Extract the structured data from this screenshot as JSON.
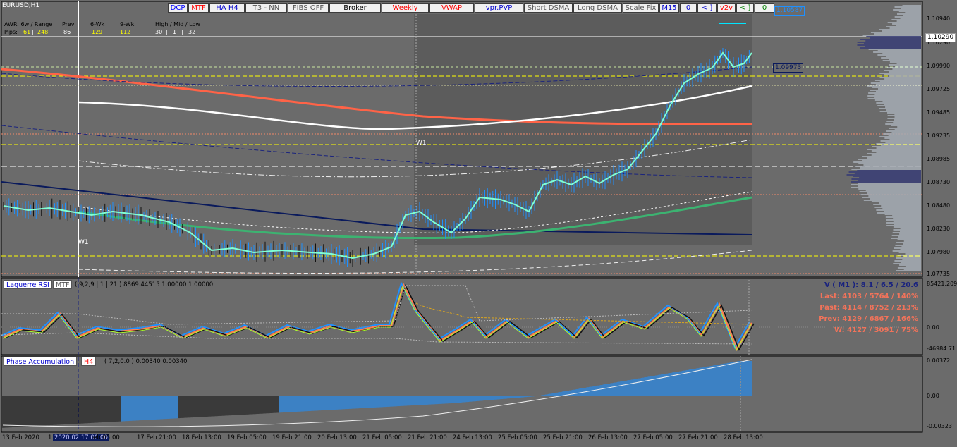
{
  "symbol": "EURUSD,H1",
  "toolbar": [
    {
      "label": "DCP",
      "color": "#0000ff",
      "bg": "#f0f0f0"
    },
    {
      "label": "MTF",
      "color": "#ff0000",
      "bg": "#f0f0f0"
    },
    {
      "label": "HA H4",
      "color": "#0000cc",
      "bg": "#f0f0f0"
    },
    {
      "label": "T3 - NN",
      "color": "#555555",
      "bg": "#f0f0f0"
    },
    {
      "label": "FIBS OFF",
      "color": "#555555",
      "bg": "#f0f0f0"
    },
    {
      "label": "Broker",
      "color": "#000000",
      "bg": "#f0f0f0"
    },
    {
      "label": "Weekly",
      "color": "#ff0000",
      "bg": "#f0f0f0"
    },
    {
      "label": "VWAP",
      "color": "#ff0000",
      "bg": "#f0f0f0"
    },
    {
      "label": "vpr.PVP",
      "color": "#0000cc",
      "bg": "#f0f0f0"
    },
    {
      "label": "Short DSMA",
      "color": "#555555",
      "bg": "#f0f0f0"
    },
    {
      "label": "Long DSMA",
      "color": "#555555",
      "bg": "#f0f0f0"
    },
    {
      "label": "Scale Fix",
      "color": "#555555",
      "bg": "#f0f0f0"
    },
    {
      "label": "M15",
      "color": "#0000cc",
      "bg": "#f0f0f0"
    },
    {
      "label": "0",
      "color": "#0000cc",
      "bg": "#f0f0f0"
    },
    {
      "label": "< ]",
      "color": "#0000cc",
      "bg": "#f0f0f0"
    },
    {
      "label": "v2v",
      "color": "#ff0000",
      "bg": "#f0f0f0"
    },
    {
      "label": "< ]",
      "color": "#008000",
      "bg": "#f0f0f0"
    },
    {
      "label": "0",
      "color": "#008000",
      "bg": "#f0f0f0"
    }
  ],
  "info": {
    "row1": {
      "awr": "AWR: 6w / Range",
      "prev": "Prev",
      "wk6": "6-Wk",
      "wk9": "9-Wk",
      "hml": "High / Mid / Low"
    },
    "row2": {
      "pips": "Pips:",
      "v1": "61",
      "sep": "|",
      "v2": "248",
      "v3": "86",
      "v4": "129",
      "v5": "112",
      "v6": "30",
      "v7": "1",
      "v8": "32"
    }
  },
  "price_axis": [
    "1.10940",
    "1.10290",
    "1.09990",
    "1.09725",
    "1.09485",
    "1.09235",
    "1.08985",
    "1.08730",
    "1.08480",
    "1.08230",
    "1.07980",
    "1.07735"
  ],
  "price_tags": {
    "high": "1.10587",
    "current": "1.10290",
    "level": "1.09973"
  },
  "w1_labels": [
    "W1",
    "W1"
  ],
  "time_axis": [
    "13 Feb 2020",
    "1",
    "2020.02.17 00:00",
    "eb 05:00",
    "17 Feb 21:00",
    "18 Feb 13:00",
    "19 Feb 05:00",
    "19 Feb 21:00",
    "20 Feb 13:00",
    "21 Feb 05:00",
    "21 Feb 21:00",
    "24 Feb 13:00",
    "25 Feb 05:00",
    "25 Feb 21:00",
    "26 Feb 13:00",
    "27 Feb 05:00",
    "27 Feb 21:00",
    "28 Feb 13:00"
  ],
  "laguerre": {
    "name": "Laguerre RSI",
    "tf": "MTF",
    "params": "( 9,2,9 | 1 | 21 ) 8869.44515 1.00000 1.00000",
    "axis": [
      "85421.209",
      "0.00",
      "-46984.71"
    ]
  },
  "stats": [
    {
      "label": "V ( M1 ): 8.1 / 6.5 / 20.6",
      "color": "#1a237e"
    },
    {
      "label": "Last: 4103 / 5764 / 140%",
      "color": "#f2735a"
    },
    {
      "label": "Past: 4114 / 8752 / 213%",
      "color": "#f2735a"
    },
    {
      "label": "Prev: 4129 / 6867 / 166%",
      "color": "#f2735a"
    },
    {
      "label": "W: 4127 / 3091 / 75%",
      "color": "#f2735a"
    }
  ],
  "phase": {
    "name": "Phase Accumulation",
    "tf": "H4",
    "params": "( 7,2,0.0 ) 0.00340 0.00340",
    "axis": [
      "0.00372",
      "0.00",
      "-0.00323"
    ]
  },
  "colors": {
    "bg": "#6b6b6b",
    "volumeBox": "#5a5a5a",
    "candleUp": "#1e90ff",
    "ema": "#ff6347",
    "mid": "#ffffff",
    "navy": "#0a1a5c",
    "green": "#3cb371"
  }
}
